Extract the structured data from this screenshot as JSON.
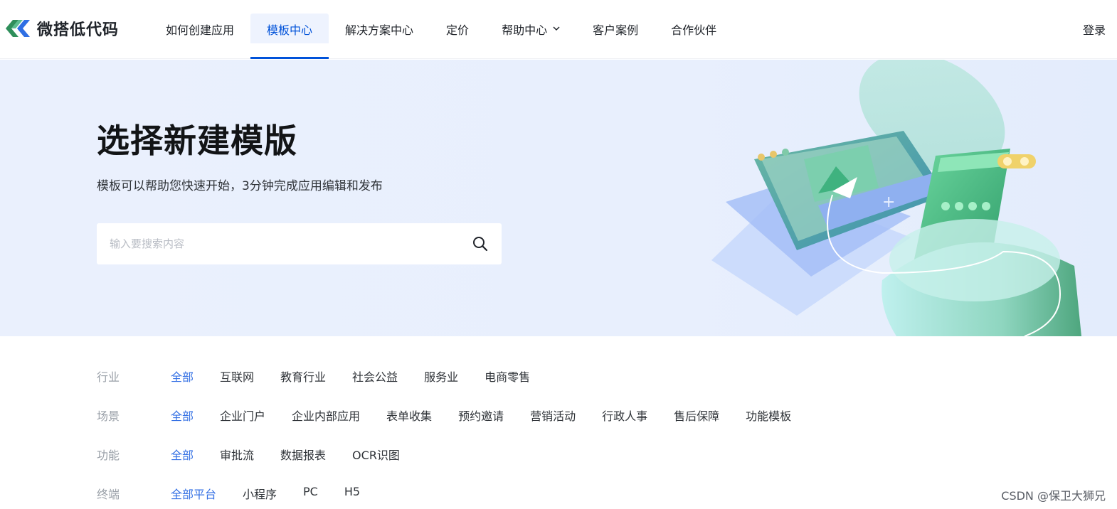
{
  "header": {
    "brand": "微搭低代码",
    "nav": [
      {
        "label": "如何创建应用",
        "active": false
      },
      {
        "label": "模板中心",
        "active": true
      },
      {
        "label": "解决方案中心",
        "active": false
      },
      {
        "label": "定价",
        "active": false
      },
      {
        "label": "帮助中心",
        "active": false,
        "dropdown": true
      },
      {
        "label": "客户案例",
        "active": false
      },
      {
        "label": "合作伙伴",
        "active": false
      }
    ],
    "login": "登录"
  },
  "hero": {
    "title": "选择新建模版",
    "subtitle": "模板可以帮助您快速开始，3分钟完成应用编辑和发布",
    "search_placeholder": "输入要搜索内容",
    "search_value": ""
  },
  "filters": [
    {
      "label": "行业",
      "options": [
        "全部",
        "互联网",
        "教育行业",
        "社会公益",
        "服务业",
        "电商零售"
      ],
      "selected": 0
    },
    {
      "label": "场景",
      "options": [
        "全部",
        "企业门户",
        "企业内部应用",
        "表单收集",
        "预约邀请",
        "营销活动",
        "行政人事",
        "售后保障",
        "功能模板"
      ],
      "selected": 0
    },
    {
      "label": "功能",
      "options": [
        "全部",
        "审批流",
        "数据报表",
        "OCR识图"
      ],
      "selected": 0
    },
    {
      "label": "终端",
      "options": [
        "全部平台",
        "小程序",
        "PC",
        "H5"
      ],
      "selected": 0
    }
  ],
  "watermark": "CSDN @保卫大狮兄",
  "colors": {
    "accent": "#0052d9",
    "filter_selected": "#3470e4",
    "hero_bg": "#e8effd"
  },
  "icons": {
    "logo": "weda-logo-icon",
    "search": "search-icon",
    "dropdown": "chevron-down-icon"
  }
}
